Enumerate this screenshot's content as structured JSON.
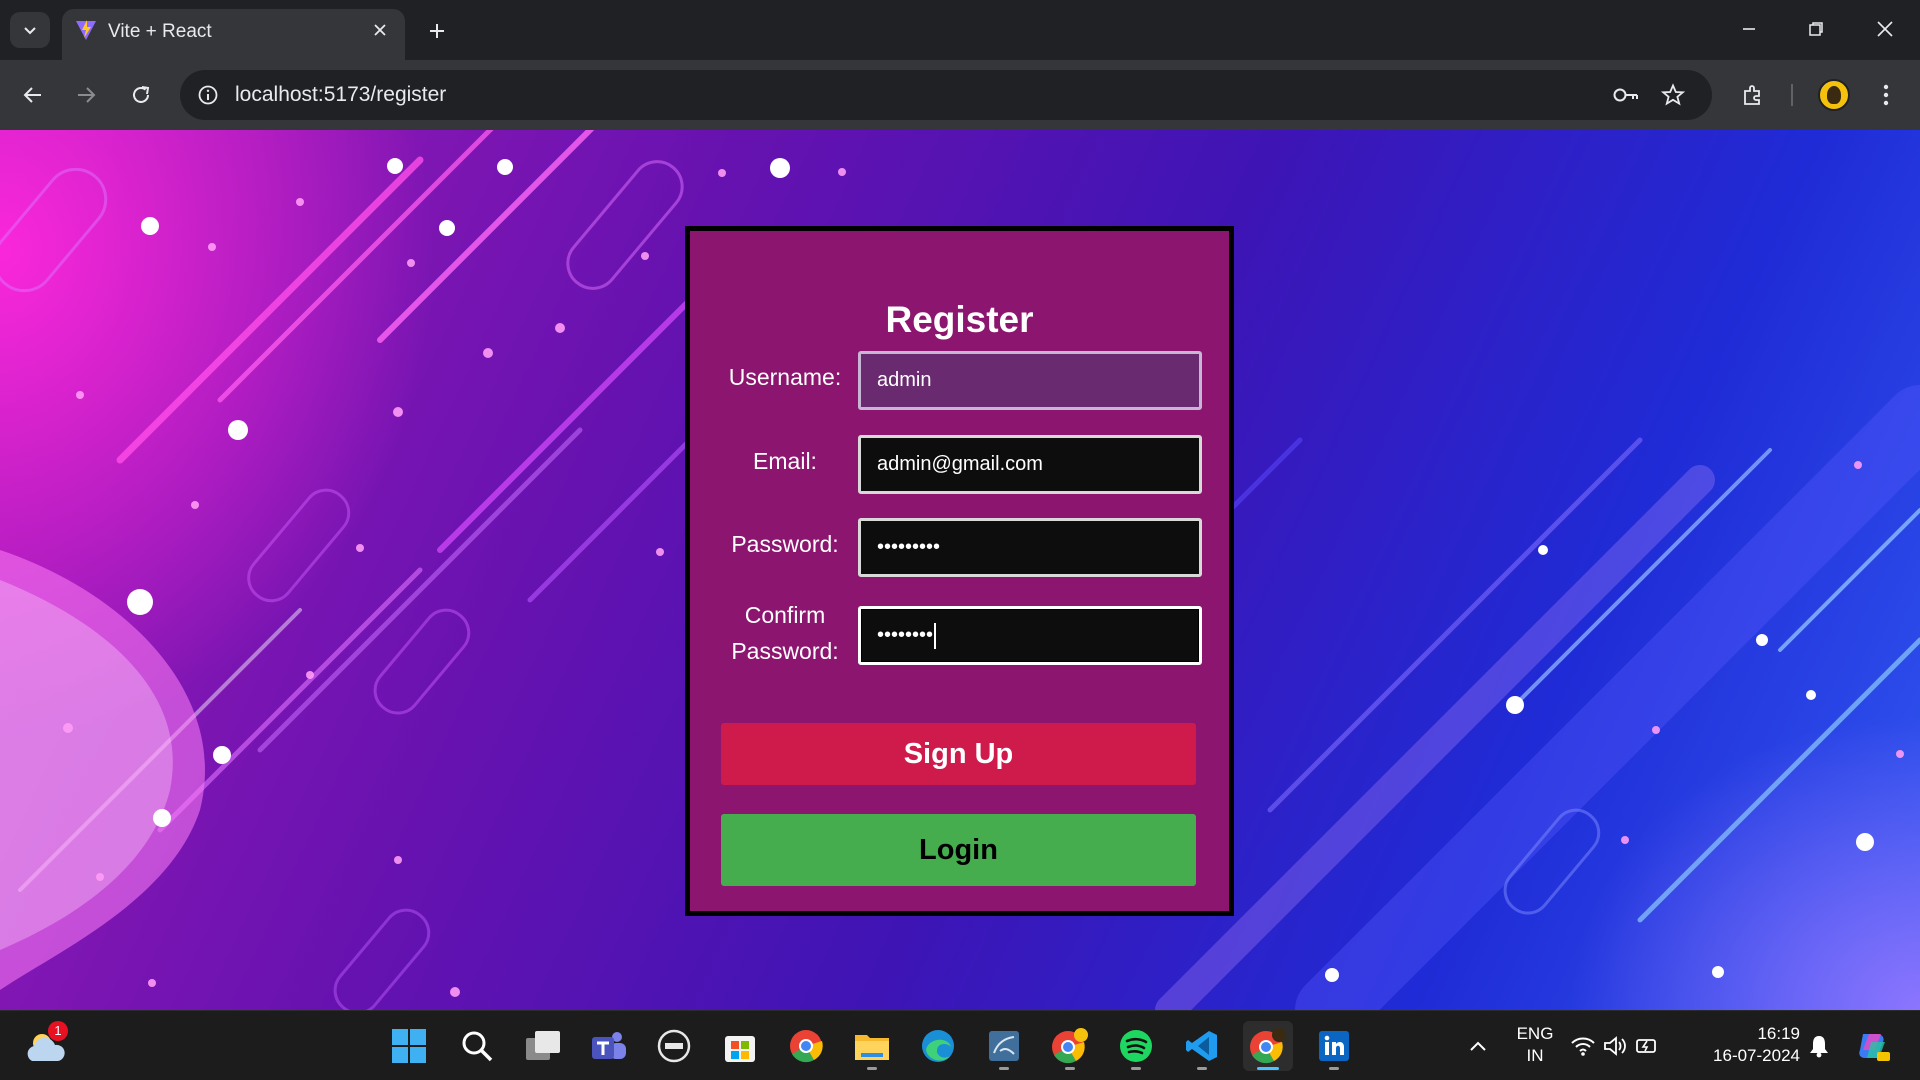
{
  "browser": {
    "tab_title": "Vite + React",
    "url": "localhost:5173/register"
  },
  "form": {
    "title": "Register",
    "username_label": "Username:",
    "username_value": "admin",
    "email_label": "Email:",
    "email_value": "admin@gmail.com",
    "password_label": "Password:",
    "password_value": "•••••••••",
    "confirm_label_line1": "Confirm",
    "confirm_label_line2": "Password:",
    "confirm_value": "••••••••",
    "signup_label": "Sign Up",
    "login_label": "Login"
  },
  "colors": {
    "signup": "#cf1a4c",
    "login": "#45ad4e",
    "form_bg": "#8c166f"
  },
  "taskbar": {
    "weather_badge": "1",
    "lang_line1": "ENG",
    "lang_line2": "IN",
    "time": "16:19",
    "date": "16-07-2024",
    "apps": [
      "windows-start-icon",
      "search-icon",
      "task-view-icon",
      "teams-icon",
      "dell-icon",
      "microsoft-store-icon",
      "chrome-icon",
      "file-explorer-icon",
      "edge-icon",
      "mysql-workbench-icon",
      "chrome-profile-icon",
      "spotify-icon",
      "vscode-icon",
      "chrome-active-icon",
      "linkedin-icon"
    ]
  }
}
